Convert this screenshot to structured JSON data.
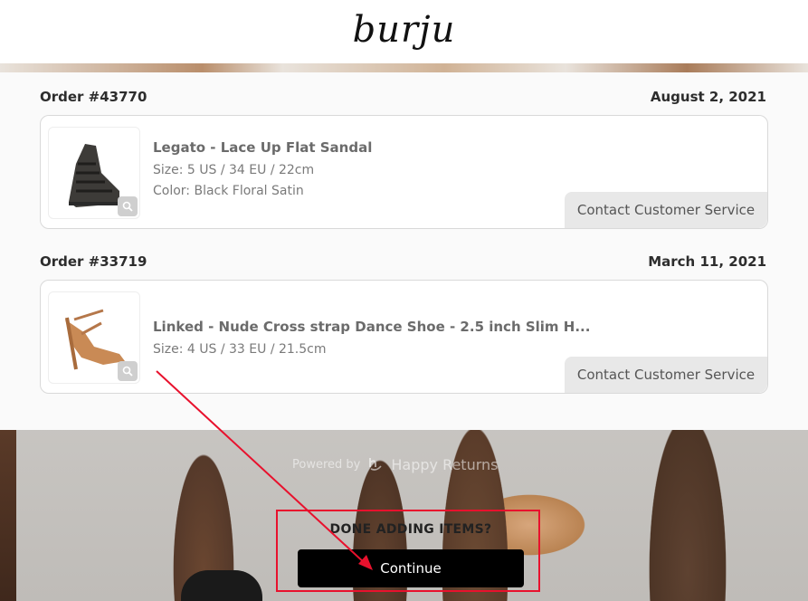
{
  "header": {
    "logo_text": "burju"
  },
  "orders": [
    {
      "order_number": "Order #43770",
      "date": "August 2, 2021",
      "item": {
        "title": "Legato - Lace Up Flat Sandal",
        "size": "Size: 5 US / 34 EU / 22cm",
        "color": "Color: Black Floral Satin"
      },
      "contact_label": "Contact Customer Service"
    },
    {
      "order_number": "Order #33719",
      "date": "March 11, 2021",
      "item": {
        "title": "Linked - Nude Cross strap Dance Shoe - 2.5 inch Slim H...",
        "size": "Size: 4 US / 33 EU / 21.5cm"
      },
      "contact_label": "Contact Customer Service"
    }
  ],
  "footer": {
    "powered_by": "Powered by",
    "powered_brand": "Happy Returns",
    "done_prompt": "DONE ADDING ITEMS?",
    "continue_label": "Continue"
  },
  "icons": [
    "magnifier-icon",
    "happy-returns-logo-icon"
  ],
  "colors": {
    "annotation_red": "#e8112d",
    "continue_bg": "#000000"
  }
}
